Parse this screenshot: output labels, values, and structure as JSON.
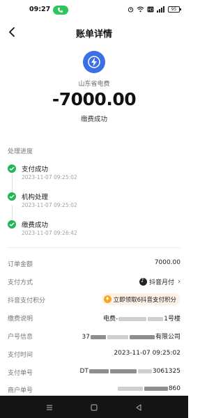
{
  "status_bar": {
    "time": "09:27",
    "battery": "95",
    "icons": [
      "call-icon",
      "alarm-icon",
      "wifi-icon",
      "hd-icon",
      "signal-icon",
      "battery-icon"
    ]
  },
  "header": {
    "title": "账单详情",
    "back_icon": "chevron-left-icon"
  },
  "summary": {
    "merchant_name": "山东省电费",
    "amount": "-7000.00",
    "status": "缴费成功",
    "logo_color": "#3b6fe6"
  },
  "progress": {
    "title": "处理进度",
    "steps": [
      {
        "label": "支付成功",
        "time": "2023-11-07 09:25:02"
      },
      {
        "label": "机构处理",
        "time": "2023-11-07 09:25:02"
      },
      {
        "label": "缴费成功",
        "time": "2023-11-07 09:26:42"
      }
    ],
    "accent": "#22b65a"
  },
  "details": {
    "order_amount": {
      "label": "订单金额",
      "value": "7000.00"
    },
    "pay_method": {
      "label": "支付方式",
      "value": "抖音月付"
    },
    "points": {
      "label": "抖音支付积分",
      "value": "立即领取6抖音支付积分"
    },
    "pay_note": {
      "label": "缴费说明",
      "prefix": "电费-",
      "suffix": "1号楼"
    },
    "account": {
      "label": "户号信息",
      "prefix": "37",
      "suffix": "有限公司"
    },
    "pay_time": {
      "label": "支付时间",
      "value": "2023-11-07 09:25:02"
    },
    "pay_no": {
      "label": "支付单号",
      "prefix": "DT",
      "suffix": "3061325"
    },
    "merchant_no": {
      "label": "商户单号",
      "suffix": "860"
    }
  },
  "nav": {
    "icons": [
      "menu-icon",
      "home-icon",
      "back-icon"
    ]
  }
}
